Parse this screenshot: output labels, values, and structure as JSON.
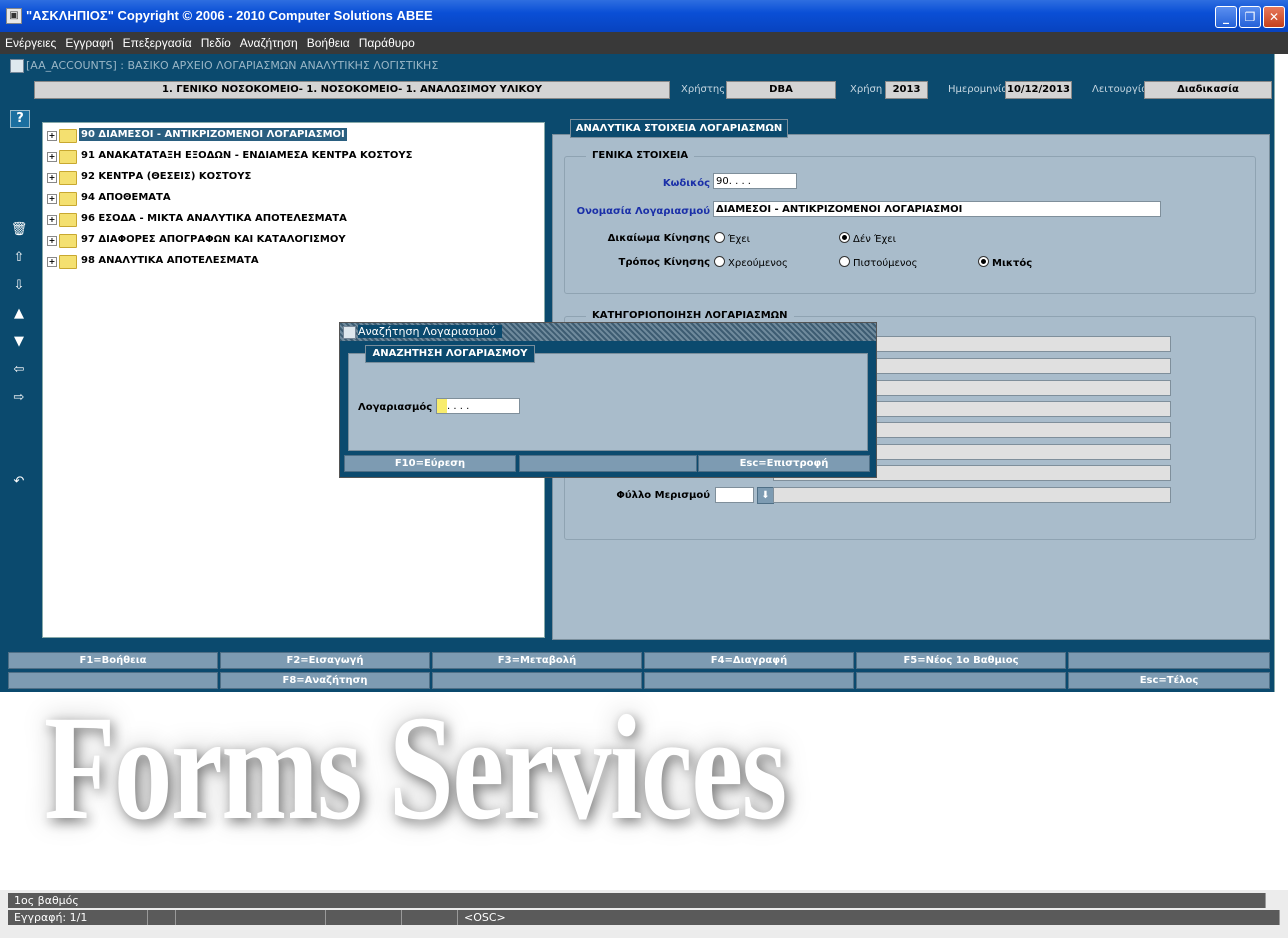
{
  "window": {
    "title": "\"ΑΣΚΛΗΠΙΟΣ\" Copyright © 2006 - 2010 Computer Solutions ΑΒΕΕ"
  },
  "menu": [
    "Ενέργειες",
    "Εγγραφή",
    "Επεξεργασία",
    "Πεδίο",
    "Αναζήτηση",
    "Βοήθεια",
    "Παράθυρο"
  ],
  "form": {
    "title": "[AA_ACCOUNTS]  :  ΒΑΣΙΚΟ ΑΡΧΕΙΟ ΛΟΓΑΡΙΑΣΜΩΝ ΑΝΑΛΥΤΙΚΗΣ ΛΟΓΙΣΤΙΚΗΣ",
    "org": "1. ΓΕΝΙΚΟ ΝΟΣΟΚΟΜΕΙΟ- 1. ΝΟΣΟΚΟΜΕΙΟ- 1. ΑΝΑΛΩΣΙΜΟΥ ΥΛΙΚΟΥ",
    "user_label": "Χρήστης",
    "user": "DBA",
    "year_label": "Χρήση",
    "year": "2013",
    "date_label": "Ημερομηνία",
    "date": "10/12/2013",
    "mode_label": "Λειτουργία",
    "mode": "Διαδικασία"
  },
  "toolbar": {
    "help": "?"
  },
  "tree": {
    "items": [
      {
        "label": "90  ΔΙΑΜΕΣΟΙ - ΑΝΤΙΚΡΙΖΟΜΕΝΟΙ ΛΟΓΑΡΙΑΣΜΟΙ",
        "selected": true
      },
      {
        "label": "91  ΑΝΑΚΑΤΑΤΑΞΗ ΕΞΟΔΩΝ - ΕΝΔΙΑΜΕΣΑ ΚΕΝΤΡΑ ΚΟΣΤΟΥΣ"
      },
      {
        "label": "92  ΚΕΝΤΡΑ (ΘΕΣΕΙΣ) ΚΟΣΤΟΥΣ"
      },
      {
        "label": "94  ΑΠΟΘΕΜΑΤΑ"
      },
      {
        "label": "96  ΕΣΟΔΑ - ΜΙΚΤΑ ΑΝΑΛΥΤΙΚΑ ΑΠΟΤΕΛΕΣΜΑΤΑ"
      },
      {
        "label": "97  ΔΙΑΦΟΡΕΣ ΑΠΟΓΡΑΦΩΝ ΚΑΙ ΚΑΤΑΛΟΓΙΣΜΟΥ"
      },
      {
        "label": "98  ΑΝΑΛΥΤΙΚΑ ΑΠΟΤΕΛΕΣΜΑΤΑ"
      }
    ]
  },
  "details": {
    "tab": "ΑΝΑΛΥΤΙΚΑ ΣΤΟΙΧΕΙΑ ΛΟΓΑΡΙΑΣΜΩΝ",
    "general_group": "ΓΕΝΙΚΑ ΣΤΟΙΧΕΙΑ",
    "code_label": "Κωδικός",
    "code_value": "90.    .    .    .",
    "name_label": "Ονομασία Λογαριασμού",
    "name_value": "ΔΙΑΜΕΣΟΙ - ΑΝΤΙΚΡΙΖΟΜΕΝΟΙ ΛΟΓΑΡΙΑΣΜΟΙ",
    "movement_right_label": "Δικαίωμα Κίνησης",
    "movement_right_options": [
      "Έχει",
      "Δέν Έχει"
    ],
    "movement_right_selected": 1,
    "movement_type_label": "Τρόπος Κίνησης",
    "movement_type_options": [
      "Χρεούμενος",
      "Πιστούμενος",
      "Μικτός"
    ],
    "movement_type_selected": 2,
    "category_group": "ΚΑΤΗΓΟΡΙΟΠΟΙΗΣΗ ΛΟΓΑΡΙΑΣΜΩΝ",
    "distribution_label": "Φύλλο Μερισμού"
  },
  "dialog": {
    "title": "Αναζήτηση Λογαριασμού",
    "tab": "ΑΝΑΖΗΤΗΣΗ ΛΟΓΑΡΙΑΣΜΟΥ",
    "account_label": "Λογαριασμός",
    "account_value": ".    .    .    .",
    "buttons": [
      "F10=Εύρεση",
      "",
      "Esc=Επιστροφή"
    ]
  },
  "function_keys": {
    "row1": [
      "F1=Βοήθεια",
      "F2=Εισαγωγή",
      "F3=Μεταβολή",
      "F4=Διαγραφή",
      "F5=Νέος 1ο Βαθμιος",
      ""
    ],
    "row2": [
      "",
      "F8=Αναζήτηση",
      "",
      "",
      "",
      "Esc=Τέλος"
    ]
  },
  "watermark": "Forms Services",
  "status": {
    "line1": "1ος βαθμός",
    "record": "Εγγραφή: 1/1",
    "osc": "<OSC>"
  },
  "colors": {
    "frame": "#0b4a6e",
    "panel": "#a9bccb",
    "button": "#7d9bb2",
    "selection": "#2a5f80"
  }
}
